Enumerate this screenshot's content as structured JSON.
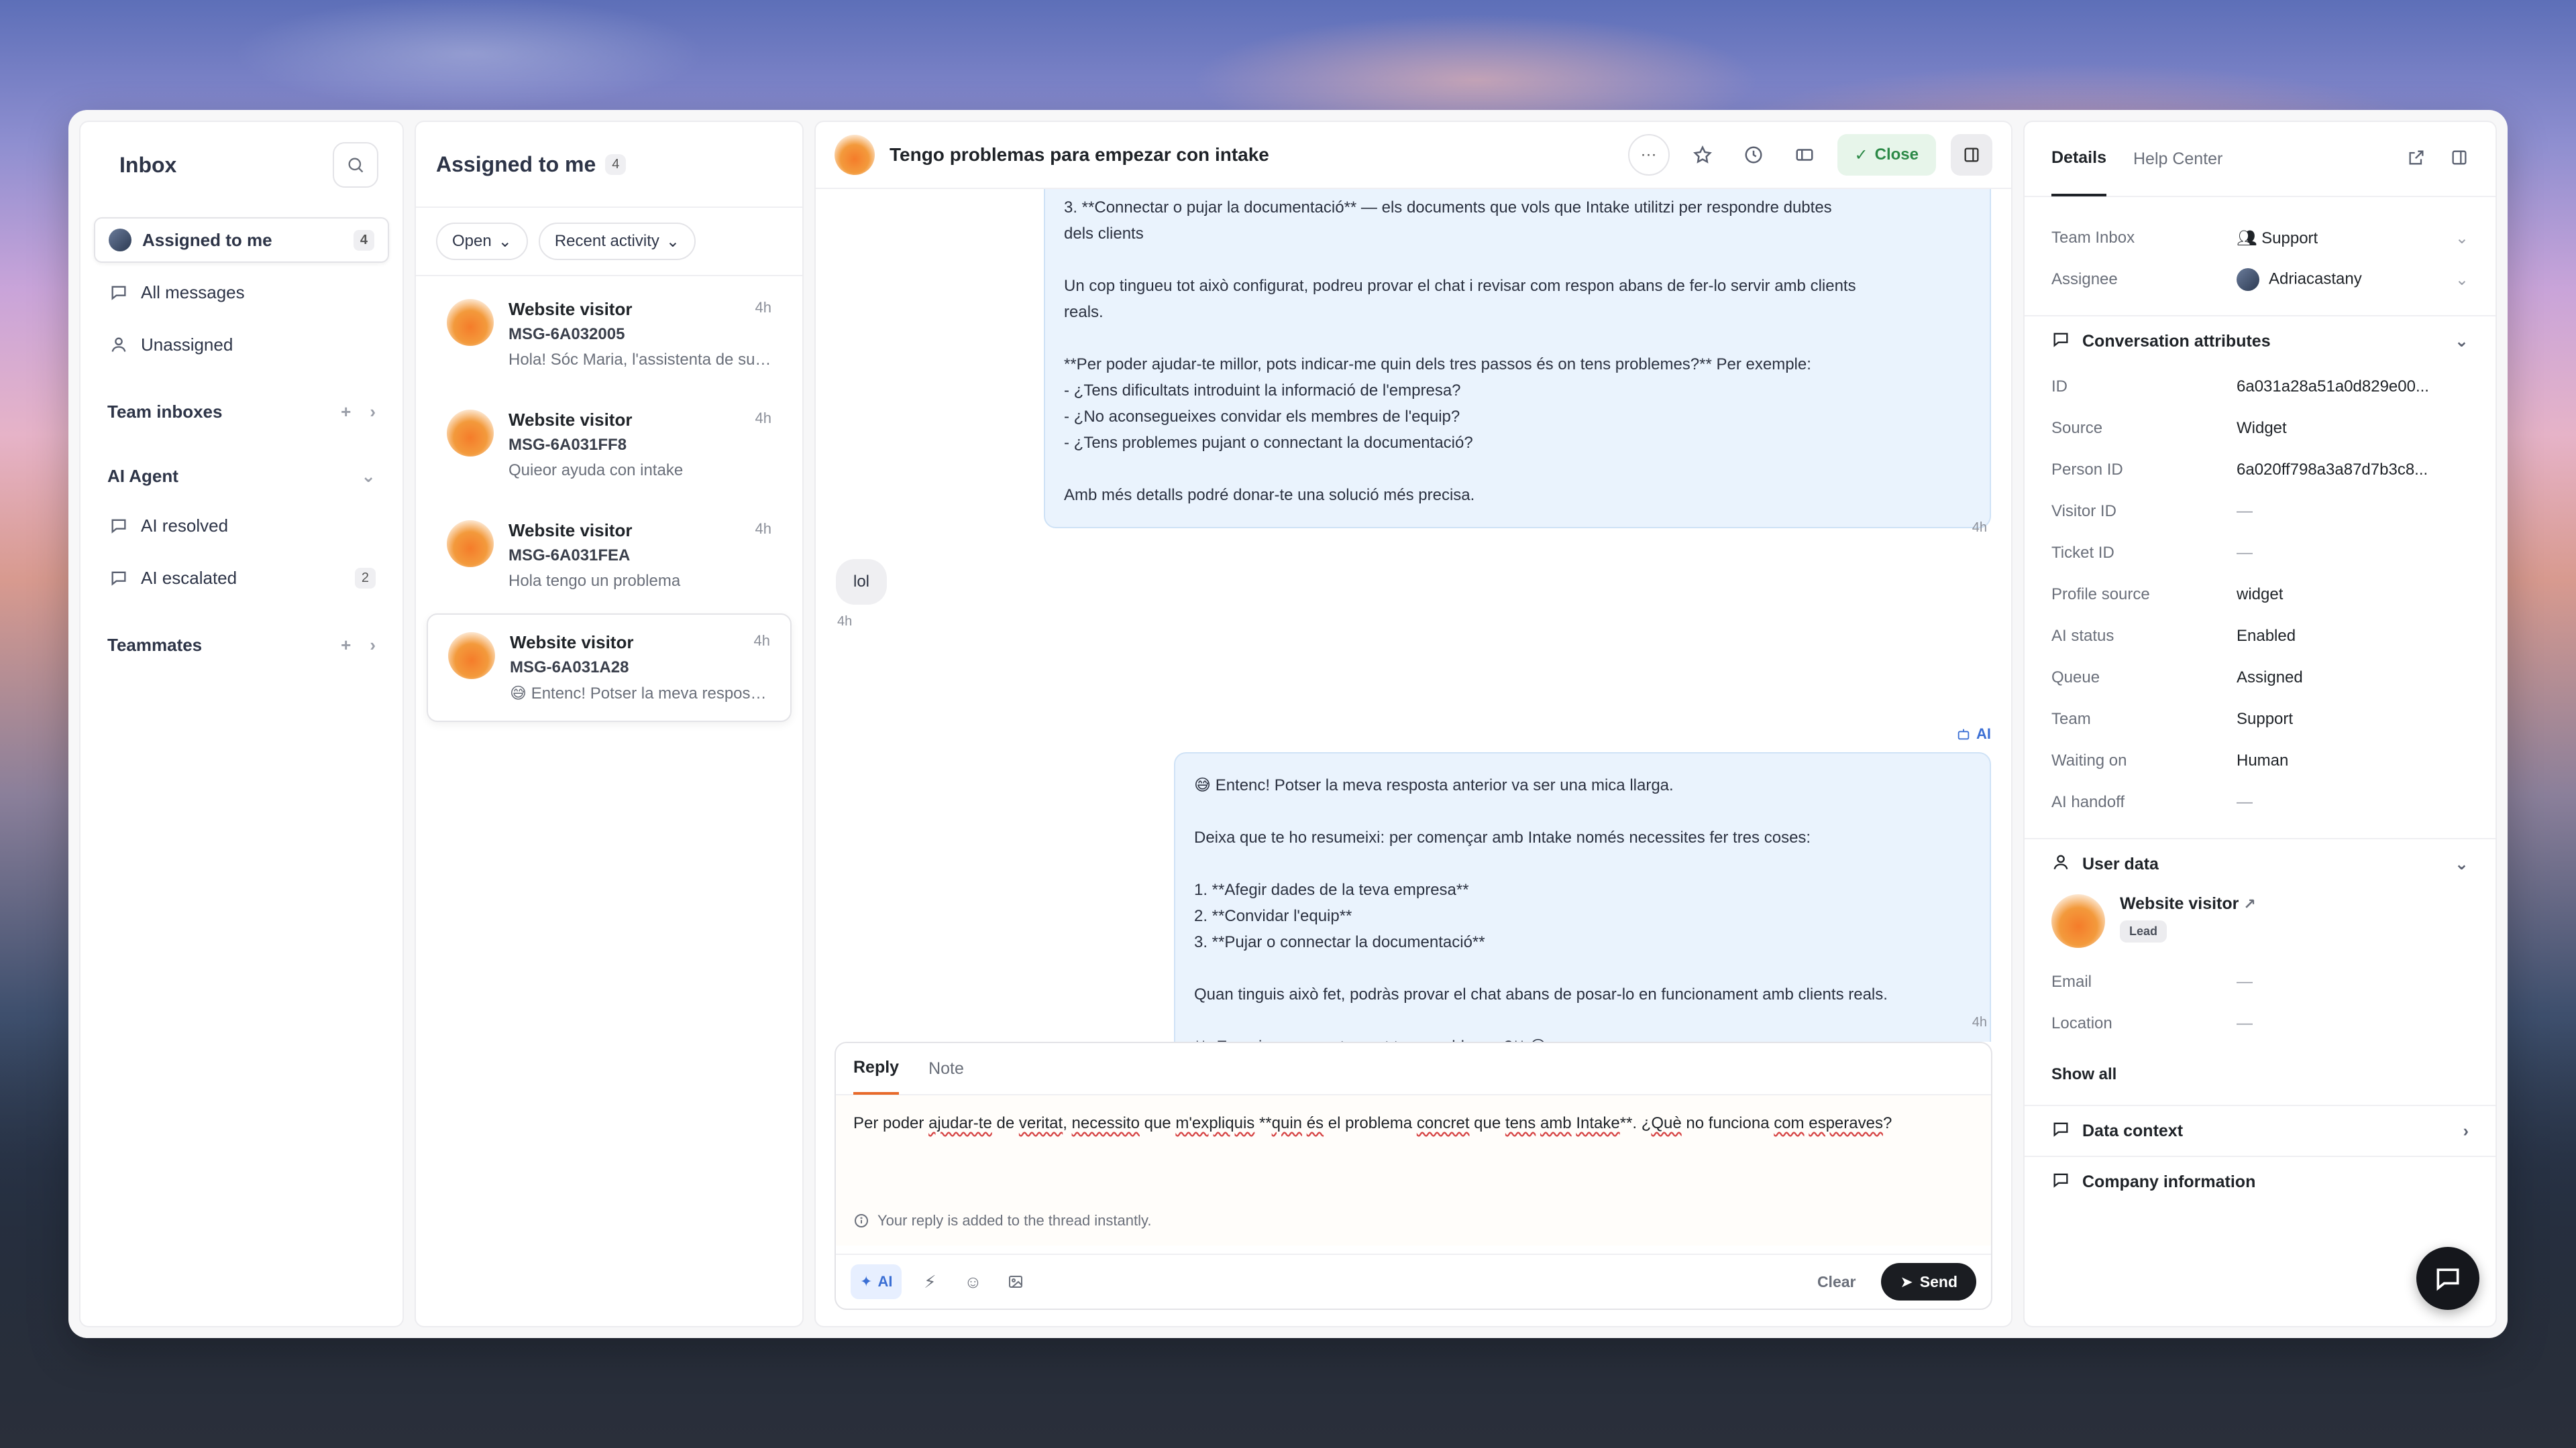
{
  "nav": {
    "title": "Inbox",
    "assigned_label": "Assigned to me",
    "assigned_count": "4",
    "all_messages": "All messages",
    "unassigned": "Unassigned",
    "team_inboxes": "Team inboxes",
    "ai_agent": "AI Agent",
    "ai_resolved": "AI resolved",
    "ai_escalated": "AI escalated",
    "ai_escalated_count": "2",
    "teammates": "Teammates"
  },
  "list": {
    "title": "Assigned to me",
    "count": "4",
    "filter_status": "Open",
    "filter_sort": "Recent activity",
    "items": [
      {
        "name": "Website visitor",
        "time": "4h",
        "id": "MSG-6A032005",
        "preview": "Hola! Sóc Maria, l'assistenta de sup..."
      },
      {
        "name": "Website visitor",
        "time": "4h",
        "id": "MSG-6A031FF8",
        "preview": "Quieor ayuda con intake"
      },
      {
        "name": "Website visitor",
        "time": "4h",
        "id": "MSG-6A031FEA",
        "preview": "Hola tengo un problema"
      },
      {
        "name": "Website visitor",
        "time": "4h",
        "id": "MSG-6A031A28",
        "preview": "😅 Entenc! Potser la meva resposta ..."
      }
    ]
  },
  "chat": {
    "title": "Tengo problemas para empezar con intake",
    "close_label": "Close",
    "msg1": "3. **Connectar o pujar la documentació** — els documents que vols que Intake utilitzi per respondre dubtes\ndels clients\n\nUn cop tingueu tot això configurat, podreu provar el chat i revisar com respon abans de fer-lo servir amb clients\nreals.\n\n**Per poder ajudar-te millor, pots indicar-me quin dels tres passos és on tens problemes?** Per exemple:\n- ¿Tens dificultats introduint la informació de l'empresa?\n- ¿No aconsegueixes convidar els membres de l'equip?\n- ¿Tens problemes pujant o connectant la documentació?\n\nAmb més detalls podré donar-te una solució més precisa.",
    "msg1_time": "4h",
    "user_msg": "lol",
    "user_time": "4h",
    "ai_tag": "AI",
    "msg2": "😅 Entenc! Potser la meva resposta anterior va ser una mica llarga.\n\nDeixa que te ho resumeixi: per començar amb Intake només necessites fer tres coses:\n\n1. **Afegir dades de la teva empresa**\n2. **Convidar l'equip**\n3. **Pujar o connectar la documentació**\n\nQuan tinguis això fet, podràs provar el chat abans de posar-lo en funcionament amb clients reals.\n\n**¿En quin pas exactament tens problemes?** 😅",
    "msg2_time": "4h"
  },
  "composer": {
    "tab_reply": "Reply",
    "tab_note": "Note",
    "text_1": "Per poder ",
    "text_2": "ajudar-te",
    "text_3": " de ",
    "text_4": "veritat",
    "text_5": ", ",
    "text_6": "necessito",
    "text_7": " que ",
    "text_8": "m'expliquis",
    "text_9": " **",
    "text_10": "quin",
    "text_11": " ",
    "text_12": "és",
    "text_13": " el problema ",
    "text_14": "concret",
    "text_15": " que ",
    "text_16": "tens",
    "text_17": " ",
    "text_18": "amb",
    "text_19": " ",
    "text_20": "Intake",
    "text_21": "**. ¿",
    "text_22": "Què",
    "text_23": " no funciona ",
    "text_24": "com",
    "text_25": " ",
    "text_26": "esperaves",
    "text_27": "?",
    "hint": "Your reply is added to the thread instantly.",
    "ai_label": "AI",
    "clear_label": "Clear",
    "send_label": "Send"
  },
  "details": {
    "tab_details": "Details",
    "tab_help": "Help Center",
    "team_inbox_label": "Team Inbox",
    "team_inbox_value": "Support",
    "assignee_label": "Assignee",
    "assignee_value": "Adriacastany",
    "conv_attrs_title": "Conversation attributes",
    "attrs": [
      {
        "k": "ID",
        "v": "6a031a28a51a0d829e00..."
      },
      {
        "k": "Source",
        "v": "Widget"
      },
      {
        "k": "Person ID",
        "v": "6a020ff798a3a87d7b3c8..."
      },
      {
        "k": "Visitor ID",
        "v": "—"
      },
      {
        "k": "Ticket ID",
        "v": "—"
      },
      {
        "k": "Profile source",
        "v": "widget"
      },
      {
        "k": "AI status",
        "v": "Enabled"
      },
      {
        "k": "Queue",
        "v": "Assigned"
      },
      {
        "k": "Team",
        "v": "Support"
      },
      {
        "k": "Waiting on",
        "v": "Human"
      },
      {
        "k": "AI handoff",
        "v": "—"
      }
    ],
    "user_data_title": "User data",
    "user_name": "Website visitor",
    "user_badge": "Lead",
    "email_label": "Email",
    "email_value": "—",
    "location_label": "Location",
    "location_value": "—",
    "show_all": "Show all",
    "data_context": "Data context",
    "company_info": "Company information"
  },
  "colors": {
    "accent": "#e86a2a",
    "ai_blue": "#3b6fd4",
    "close_green": "#2d8a48"
  }
}
